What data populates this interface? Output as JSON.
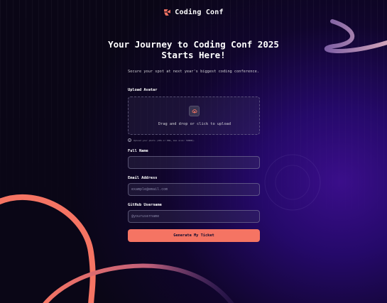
{
  "brand": {
    "name": "Coding Conf",
    "icon": "logo-mark-icon"
  },
  "hero": {
    "title_line1": "Your Journey to Coding Conf 2025",
    "title_line2": "Starts Here!",
    "subtitle": "Secure your spot at next year's biggest coding conference."
  },
  "form": {
    "avatar": {
      "label": "Upload Avatar",
      "dropzone_text": "Drag and drop or click to upload",
      "hint": "Upload your photo (JPG or PNG, max size: 500KB)."
    },
    "full_name": {
      "label": "Full Name",
      "value": "",
      "placeholder": ""
    },
    "email": {
      "label": "Email Address",
      "value": "",
      "placeholder": "example@email.com"
    },
    "github": {
      "label": "GitHub Username",
      "value": "",
      "placeholder": "@yourusername"
    },
    "submit_label": "Generate My Ticket"
  },
  "colors": {
    "accent": "#f57463",
    "background": "#0a0616",
    "purple_glow": "#3a0e8a"
  }
}
